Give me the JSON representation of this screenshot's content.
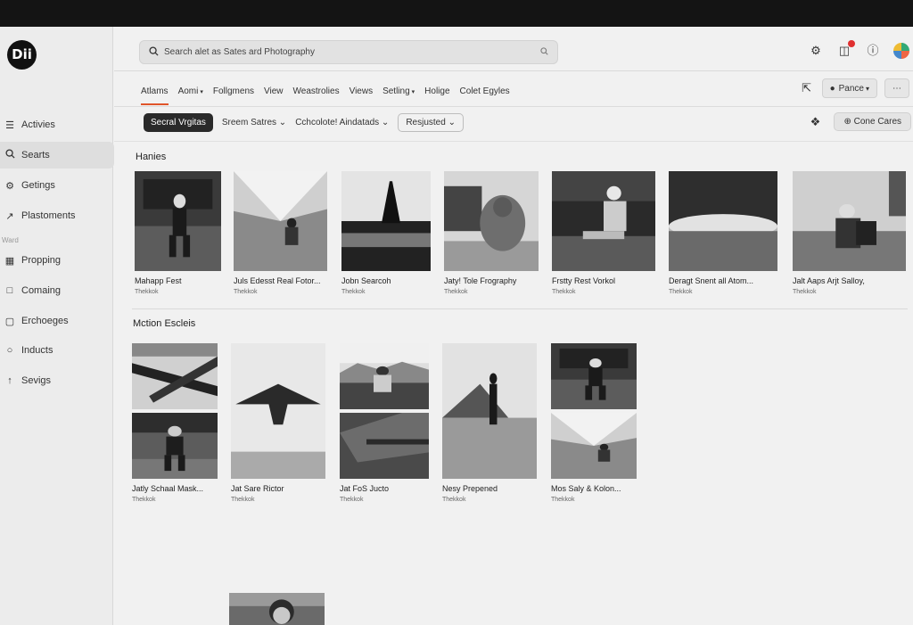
{
  "app": {
    "logo_text": "Dii"
  },
  "sidebar": {
    "caption": "Ward",
    "items": [
      {
        "label": "Activies",
        "icon": "list-icon"
      },
      {
        "label": "Searts",
        "icon": "search-icon"
      },
      {
        "label": "Getings",
        "icon": "settings-icon"
      },
      {
        "label": "Plastoments",
        "icon": "link-icon"
      },
      {
        "label": "Propping",
        "icon": "calendar-icon"
      },
      {
        "label": "Comaing",
        "icon": "chat-icon"
      },
      {
        "label": "Erchoeges",
        "icon": "chat-icon"
      },
      {
        "label": "Inducts",
        "icon": "circle-icon"
      },
      {
        "label": "Sevigs",
        "icon": "pin-icon"
      }
    ]
  },
  "search": {
    "placeholder": "Search alet as Sates ard Photography"
  },
  "nav": {
    "tabs": [
      "Atlams",
      "Aomi",
      "Follgmens",
      "View",
      "Weastrolies",
      "Views",
      "Setling",
      "Holige",
      "Colet Egyles"
    ],
    "tab_dropdown": [
      false,
      true,
      false,
      false,
      false,
      false,
      true,
      false,
      false
    ],
    "right_button": "Pance"
  },
  "filters": {
    "chips": [
      "Secral Vrgitas",
      "Sreem Satres",
      "Cchcolote! Aindatads",
      "Resjusted"
    ],
    "right_button": "Cone Cares"
  },
  "sections": [
    {
      "title": "Hanies",
      "cards": [
        {
          "title": "Mahapp Fest",
          "meta": "Thekkok"
        },
        {
          "title": "Juls Edesst Real Fotor...",
          "meta": "Thekkok"
        },
        {
          "title": "Jobn Searcoh",
          "meta": "Thekkok"
        },
        {
          "title": "Jaty! Tole Frography",
          "meta": "Thekkok"
        },
        {
          "title": "Frstty Rest Vorkol",
          "meta": "Thekkok"
        },
        {
          "title": "Deragt Snent all Atom...",
          "meta": "Thekkok"
        },
        {
          "title": "Jalt Aaps Arjt Salloy,",
          "meta": "Thekkok"
        }
      ]
    },
    {
      "title": "Mction Escleis",
      "cards": [
        {
          "title": "Jatly Schaal Mask...",
          "meta": "Thekkok"
        },
        {
          "title": "Jat Sare Rictor",
          "meta": "Thekkok"
        },
        {
          "title": "Jat FoS Jucto",
          "meta": "Thekkok"
        },
        {
          "title": "Nesy Prepened",
          "meta": "Thekkok"
        },
        {
          "title": "Mos Saly & Kolon...",
          "meta": "Thekkok"
        }
      ]
    }
  ],
  "colors": {
    "accent": "#e0552a",
    "badge": "#e03030",
    "chip_dark": "#2a2a2a"
  }
}
